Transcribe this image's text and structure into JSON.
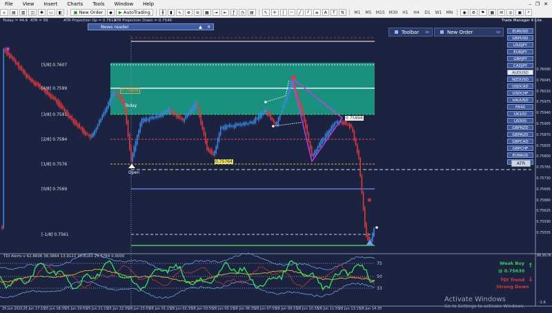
{
  "menu": [
    "File",
    "View",
    "Insert",
    "Charts",
    "Tools",
    "Window",
    "Help"
  ],
  "toolbar": {
    "new_order": "New Order",
    "autotrading": "AutoTrading",
    "timeframes": [
      "M1",
      "M5",
      "M15",
      "M30",
      "H1",
      "H4",
      "D1",
      "W1",
      "MN"
    ]
  },
  "header": {
    "today": "Today = 44.6",
    "atr": "ATR = 56",
    "projection_up": "ATR Projection Up = 0.7613",
    "projection_down": "ATR Projection Down = 0.7546",
    "news_reader": "News reader",
    "trade_manager": "Trade Manager 4 Lite"
  },
  "panels": {
    "toolbar": "Toolbar",
    "new_order": "New Order"
  },
  "symbols": [
    "EURUSD",
    "GBPUSD",
    "USDJPY",
    "EURJPY",
    "GBPJPY",
    "CADJPY",
    "AUDUSD",
    "NZDUSD",
    "USDCAD",
    "USDCHF",
    "XAUUSD",
    "FR40",
    "UK100",
    "US500",
    "GBPNZD",
    "GBPAUD",
    "GBPCAD",
    "GBPCHF",
    "EURAUD",
    "EURGBP"
  ],
  "active_symbol": "AUDUSD",
  "atr_button": "ATR",
  "levels": [
    {
      "label": "[5/8]  0.7607",
      "color": "#e8e25a"
    },
    {
      "label": "[4/8]  0.7599",
      "color": "#ffffff"
    },
    {
      "label": "[3/8]  0.7591",
      "color": "#46d35c"
    },
    {
      "label": "[2/8]  0.7584",
      "color": "#e24f4f"
    },
    {
      "label": "[1/8]  0.7576",
      "color": "#e0a84a"
    },
    {
      "label": "[0/8]  0.7569",
      "color": "#5a7fe0"
    },
    {
      "label": "[-1/8]  0.7561",
      "color": "#ffffff"
    }
  ],
  "chart_labels": {
    "today": "Today",
    "open": "Open",
    "tag_high": "0.75928",
    "tag_mid": "0.75898",
    "tag_low": "0.75764"
  },
  "price_axis": [
    "0.76090",
    "0.76045",
    "0.76010",
    "0.75975",
    "0.75940",
    "0.75905",
    "0.75870",
    "0.75835",
    "0.75800",
    "0.75765",
    "0.75730",
    "0.75695",
    "0.75660",
    "0.75625",
    "0.75590",
    "0.75555"
  ],
  "indicator": {
    "name": "TDI Alerts v 62.8606 38.3864 13.9122 30.8183 25.5784 0.0000",
    "scale": [
      "75",
      "50",
      "33"
    ],
    "top_value": "86.9576",
    "bottom_value": "-1.6",
    "weak_buy": "Weak Buy",
    "weak_buy_price": "@ 0.75630",
    "tdi_trend": "TDI Trend",
    "strong_down": "Strong Down"
  },
  "date_axis": [
    "25 Jun 2021",
    "25 Jun 17:15",
    "25 Jun 18:35",
    "25 Jun 19:55",
    "25 Jun 21:15",
    "25 Jun 22:35",
    "28 Jun 23:55",
    "28 Jun 01:15",
    "28 Jun 02:35",
    "28 Jun 03:55",
    "28 Jun 05:15",
    "28 Jun 06:35",
    "28 Jun 07:55",
    "28 Jun 09:15",
    "28 Jun 10:35",
    "28 Jun 11:55",
    "28 Jun 13:15",
    "28 Jun 14:35"
  ],
  "watermark": {
    "title": "Activate Windows",
    "sub": "Go to Settings to activate Windows."
  },
  "colors": {
    "bg": "#1b2340",
    "bull": "#3a88e0",
    "bear": "#e03a3a",
    "zone": "#1aa58a",
    "tdi_green": "#34e85a",
    "tdi_blue": "#6fa2e8",
    "tdi_yellow": "#d8c72c",
    "pattern": "#c040e0"
  }
}
